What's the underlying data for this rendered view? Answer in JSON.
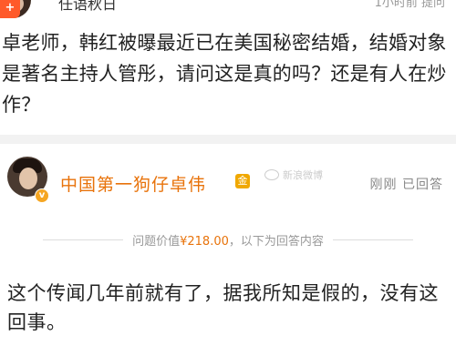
{
  "top": {
    "name": "任语秋日",
    "meta": "1小时前 提问"
  },
  "question": {
    "text": "卓老师，韩红被曝最近已在美国秘密结婚，结婚对象是著名主持人管彤，请问这是真的吗？还是有人在炒作？"
  },
  "answer": {
    "author": "中国第一狗仔卓伟",
    "level_badge": "金",
    "verified_badge": "v",
    "status": "刚刚 已回答",
    "watermark": "新浪微博",
    "price_label": "问题价值",
    "price_value": "¥218.00",
    "price_suffix": "，以下为回答内容",
    "body": "这个传闻几年前就有了，据我所知是假的，没有这回事。"
  },
  "corner": {
    "label": "+"
  },
  "colors": {
    "accent": "#e8730b",
    "corner": "#ff5a2a"
  }
}
